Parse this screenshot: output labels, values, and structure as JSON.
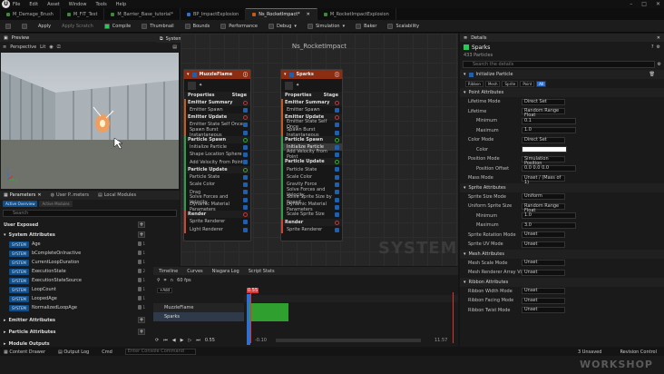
{
  "menu": {
    "items": [
      "File",
      "Edit",
      "Asset",
      "Window",
      "Tools",
      "Help"
    ]
  },
  "tabs": [
    "M_Damage_Brush",
    "M_FIT_Test",
    "M_Barrier_Base_tutorial*",
    "BP_ImpactExplosion",
    "Ns_RocketImpact*",
    "M_RocketImpactExplosion"
  ],
  "toolbar": {
    "apply": "Apply",
    "apply_scratch": "Apply Scratch",
    "compile": "Compile",
    "thumbnail": "Thumbnail",
    "bounds": "Bounds",
    "performance": "Performance",
    "debug": "Debug",
    "simulation": "Simulation",
    "baker": "Baker",
    "scalability": "Scalability"
  },
  "preview": {
    "title": "Preview",
    "perspective": "Perspective",
    "lit": "Lit"
  },
  "system_overview": {
    "tab": "System Overview",
    "title": "Ns_RocketImpact",
    "watermark": "SYSTEM"
  },
  "params": {
    "tabs": [
      "Parameters",
      "User P..meters",
      "Local Modules"
    ],
    "pills": [
      "Active Overview",
      "Active Modules"
    ],
    "search": "Search",
    "user_exposed": "User Exposed",
    "system_attributes": "System Attributes",
    "sys": "SYSTEM",
    "attrs": [
      "Age",
      "bCompleteOnInactive",
      "CurrentLoopDuration",
      "ExecutionState",
      "ExecutionStateSource",
      "LoopCount",
      "LoopedAge",
      "NormalizedLoopAge"
    ],
    "counts": [
      "1",
      "1",
      "1",
      "2",
      "1",
      "1",
      "1",
      "1"
    ],
    "emitter": "Emitter Attributes",
    "particle": "Particle Attributes",
    "module": "Module Outputs"
  },
  "node1": {
    "name": "MuzzleFlame",
    "props": "Properties",
    "stage": "Stage",
    "items": [
      [
        "sec",
        "Emitter Summary"
      ],
      [
        "i",
        "Emitter Spawn"
      ],
      [
        "sec",
        "Emitter Update"
      ],
      [
        "i",
        "Emitter State  Self  Once"
      ],
      [
        "i",
        "Spawn Burst Instantaneous"
      ],
      [
        "sec",
        "Particle Spawn"
      ],
      [
        "i",
        "Initialize Particle"
      ],
      [
        "i",
        "Shape Location  Sphere"
      ],
      [
        "i",
        "Add Velocity  From Point"
      ],
      [
        "sec",
        "Particle Update"
      ],
      [
        "i",
        "Particle State"
      ],
      [
        "i",
        "Scale Color"
      ],
      [
        "i",
        "Drag"
      ],
      [
        "i",
        "Solve Forces and Velocity"
      ],
      [
        "i",
        "Dynamic Material Parameters"
      ],
      [
        "sec",
        "Render"
      ],
      [
        "i",
        "Sprite Renderer"
      ],
      [
        "i",
        "Light Renderer"
      ]
    ]
  },
  "node2": {
    "name": "Sparks",
    "props": "Properties",
    "stage": "Stage",
    "items": [
      [
        "sec",
        "Emitter Summary"
      ],
      [
        "i",
        "Emitter Spawn"
      ],
      [
        "sec",
        "Emitter Update"
      ],
      [
        "i",
        "Emitter State  Self  Once"
      ],
      [
        "i",
        "Spawn Burst Instantaneous"
      ],
      [
        "sec",
        "Particle Spawn"
      ],
      [
        "sel",
        "Initialize Particle"
      ],
      [
        "i",
        "Add Velocity  From Point"
      ],
      [
        "sec",
        "Particle Update"
      ],
      [
        "i",
        "Particle State"
      ],
      [
        "i",
        "Scale Color"
      ],
      [
        "i",
        "Gravity Force"
      ],
      [
        "i",
        "Solve Forces and Velocity"
      ],
      [
        "i",
        "Solve Sprite Size by Speed"
      ],
      [
        "i",
        "Dynamic Material Parameters"
      ],
      [
        "i",
        "Scale Sprite Size"
      ],
      [
        "sec",
        "Render"
      ],
      [
        "i",
        "Sprite Renderer"
      ]
    ]
  },
  "details": {
    "tab": "Details",
    "name": "Sparks",
    "count": "433 Particles",
    "search": "Search the details",
    "module": "Initialize Particle",
    "filters": [
      "Ribbon",
      "Mesh",
      "Sprite",
      "Point",
      "All"
    ],
    "rows": [
      [
        "sec",
        "Point Attributes"
      ],
      [
        "r",
        "Lifetime Mode",
        "Direct Set"
      ],
      [
        "r",
        "Lifetime",
        "Random Range Float"
      ],
      [
        "r2",
        "Minimum",
        "0.1"
      ],
      [
        "r2",
        "Maximum",
        "1.0"
      ],
      [
        "r",
        "Color Mode",
        "Direct Set"
      ],
      [
        "r2",
        "Color",
        ""
      ],
      [
        "r",
        "Position Mode",
        "Simulation Position"
      ],
      [
        "r2",
        "Position Offset",
        "0.0   0.0   0.0"
      ],
      [
        "r",
        "Mass Mode",
        "Unset / (Mass of 1)"
      ],
      [
        "sec",
        "Sprite Attributes"
      ],
      [
        "r",
        "Sprite Size Mode",
        "Uniform"
      ],
      [
        "r",
        "Uniform Sprite Size",
        "Random Range Float"
      ],
      [
        "r2",
        "Minimum",
        "1.0"
      ],
      [
        "r2",
        "Maximum",
        "3.0"
      ],
      [
        "r",
        "Sprite Rotation Mode",
        "Unset"
      ],
      [
        "r",
        "Sprite UV Mode",
        "Unset"
      ],
      [
        "sec",
        "Mesh Attributes"
      ],
      [
        "r",
        "Mesh Scale Mode",
        "Unset"
      ],
      [
        "r",
        "Mesh Renderer Array Visibil",
        "Unset"
      ],
      [
        "sec",
        "Ribbon Attributes"
      ],
      [
        "r",
        "Ribbon Width Mode",
        "Unset"
      ],
      [
        "r",
        "Ribbon Facing Mode",
        "Unset"
      ],
      [
        "r",
        "Ribbon Twist Mode",
        "Unset"
      ]
    ]
  },
  "timeline": {
    "tabs": [
      "Timeline",
      "Curves",
      "Niagara Log",
      "Script Stats"
    ],
    "add": "+Add",
    "fps": "60 fps",
    "rows": [
      "MuzzleFlame",
      "Sparks"
    ],
    "ticks": [
      "-0.45",
      "0.55",
      "1.55",
      "10.15",
      "10.55",
      "11.57"
    ],
    "current": "0.55",
    "start": "-0.10",
    "end": "11.57"
  },
  "bottom": {
    "content_drawer": "Content Drawer",
    "output_log": "Output Log",
    "cmd": "Cmd",
    "console": "Enter Console Command",
    "unsaved": "3 Unsaved",
    "revision": "Revision Control"
  },
  "watermark": "WORKSHOP"
}
